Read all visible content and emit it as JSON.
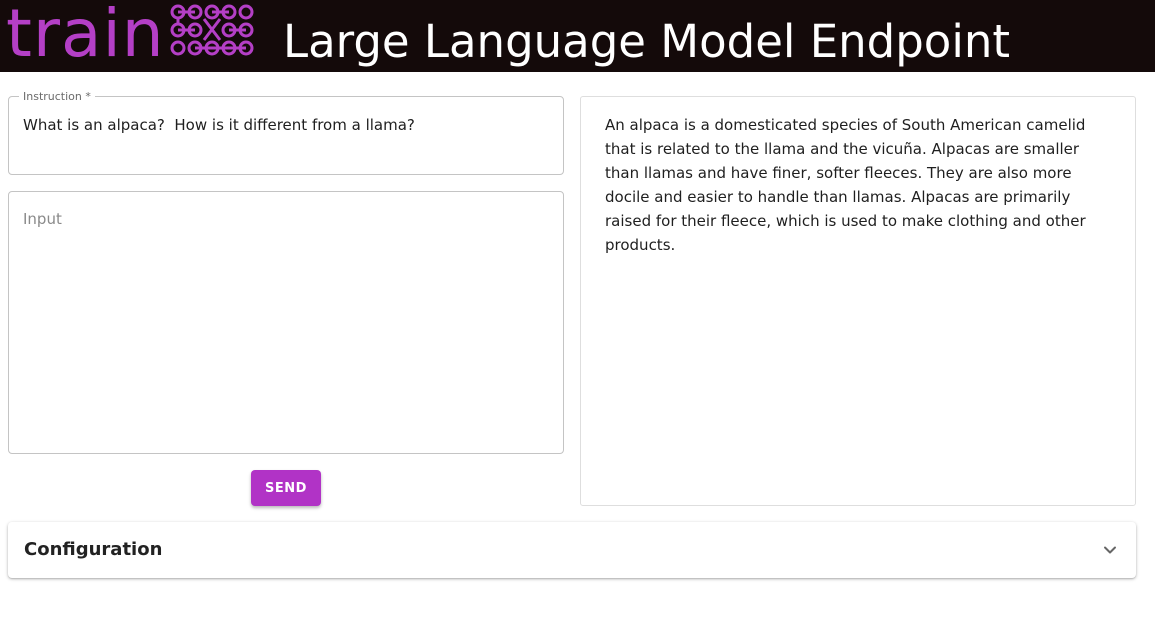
{
  "header": {
    "logo_text": "train",
    "title": "Large Language Model Endpoint",
    "brand_color": "#b43fc6",
    "background_color": "#140a0a"
  },
  "instruction": {
    "label": "Instruction *",
    "value": "What is an alpaca?  How is it different from a llama?"
  },
  "input": {
    "placeholder": "Input",
    "value": ""
  },
  "send_button": {
    "label": "SEND",
    "color": "#b133c6"
  },
  "output": {
    "text": "An alpaca is a domesticated species of South American camelid that is related to the llama and the vicuña. Alpacas are smaller than llamas and have finer, softer fleeces. They are also more docile and easier to handle than llamas. Alpacas are primarily raised for their fleece, which is used to make clothing and other products."
  },
  "configuration": {
    "title": "Configuration",
    "icon": "chevron-down-icon",
    "expanded": false
  }
}
